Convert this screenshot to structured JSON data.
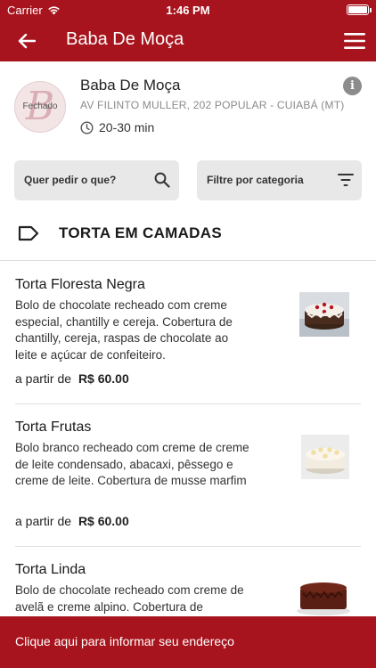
{
  "status_bar": {
    "carrier": "Carrier",
    "time": "1:46 PM"
  },
  "nav": {
    "title": "Baba De Moça",
    "back_icon": "arrow-left-icon",
    "menu_icon": "hamburger-menu-icon"
  },
  "store": {
    "name": "Baba De Moça",
    "address": "AV FILINTO MULLER, 202 POPULAR - CUIABÁ (MT)",
    "delivery_time": "20-30 min",
    "status_badge": "Fechado"
  },
  "search": {
    "placeholder": "Quer pedir o que?"
  },
  "filter": {
    "label": "Filtre por categoria"
  },
  "category": {
    "title": "TORTA EM CAMADAS"
  },
  "products": [
    {
      "name": "Torta Floresta Negra",
      "description": "Bolo de chocolate recheado com creme especial, chantilly e cereja. Cobertura de chantilly, cereja, raspas de chocolate ao leite e açúcar de confeiteiro.",
      "price_prefix": "a partir de",
      "price": "R$ 60.00"
    },
    {
      "name": "Torta Frutas",
      "description": "Bolo branco recheado com creme de creme de leite condensado, abacaxi, pêssego e creme de leite. Cobertura de musse marfim",
      "price_prefix": "a partir de",
      "price": "R$ 60.00"
    },
    {
      "name": "Torta Linda",
      "description": "Bolo de chocolate recheado com creme de avelã e creme alpino. Cobertura de chantilly, chocolate e raspas",
      "price_prefix": "a partir de",
      "price": ""
    }
  ],
  "bottom_banner": {
    "label": "Clique aqui para informar seu endereço"
  },
  "colors": {
    "brand": "#a8141d",
    "input_bg": "#e8e8e8",
    "muted_text": "#8a8a8a"
  }
}
